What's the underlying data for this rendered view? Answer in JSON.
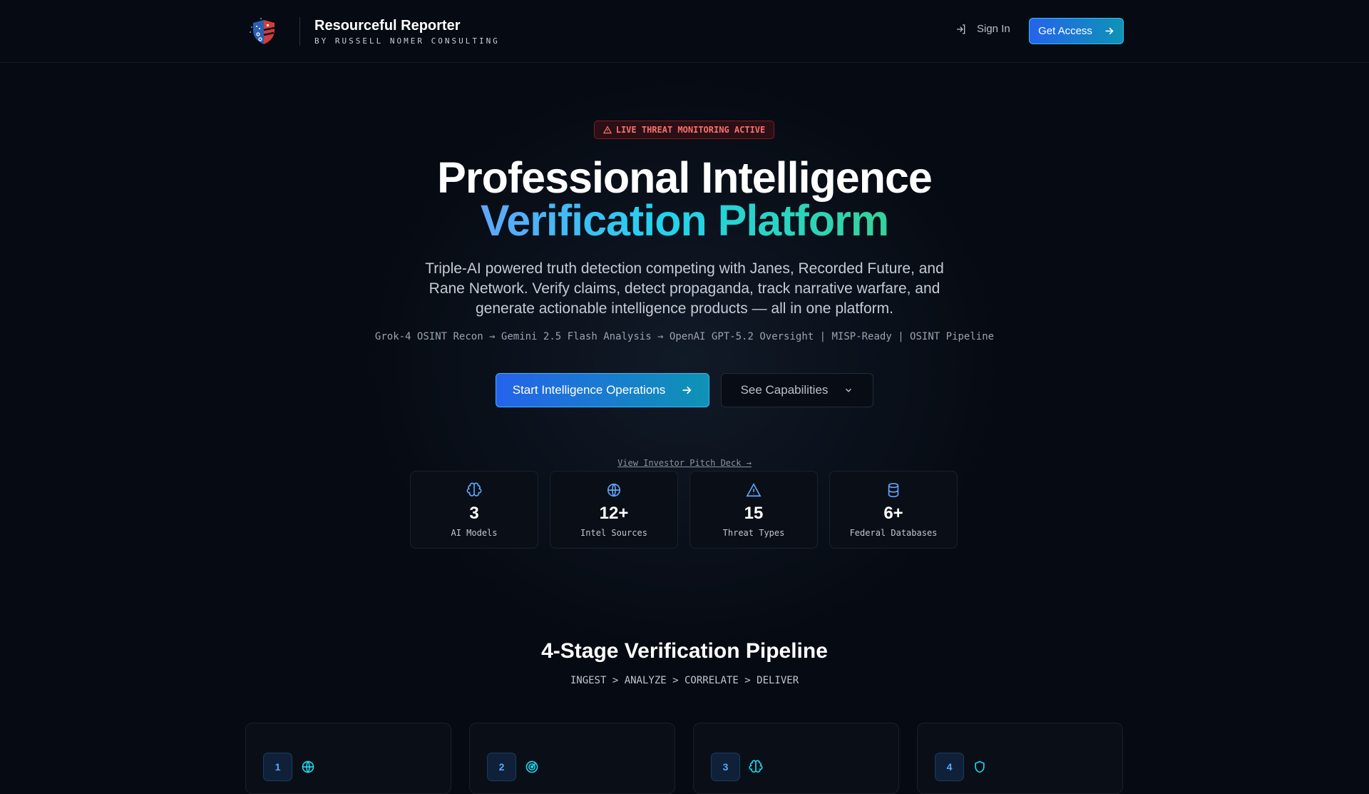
{
  "header": {
    "brand": "Resourceful Reporter",
    "subtitle": "BY RUSSELL NOMER CONSULTING",
    "sign_in": "Sign In",
    "get_access": "Get Access"
  },
  "hero": {
    "badge": "LIVE THREAT MONITORING ACTIVE",
    "title_line1": "Professional Intelligence",
    "title_line2": "Verification Platform",
    "lead": "Triple-AI powered truth detection competing with Janes, Recorded Future, and Rane Network. Verify claims, detect propaganda, track narrative warfare, and generate actionable intelligence products — all in one platform.",
    "pipeline": "Grok-4 OSINT Recon → Gemini 2.5 Flash Analysis → OpenAI GPT-5.2 Oversight | MISP-Ready | OSINT Pipeline",
    "primary_cta": "Start Intelligence Operations",
    "secondary_cta": "See Capabilities",
    "pitch_link": "View Investor Pitch Deck →"
  },
  "stats": [
    {
      "icon": "brain-icon",
      "value": "3",
      "label": "AI Models"
    },
    {
      "icon": "globe-icon",
      "value": "12+",
      "label": "Intel Sources"
    },
    {
      "icon": "warning-icon",
      "value": "15",
      "label": "Threat Types"
    },
    {
      "icon": "database-icon",
      "value": "6+",
      "label": "Federal Databases"
    }
  ],
  "pipeline_section": {
    "title": "4-Stage Verification Pipeline",
    "subtitle": "INGEST > ANALYZE > CORRELATE > DELIVER",
    "stages": [
      {
        "number": "1",
        "icon": "globe-icon"
      },
      {
        "number": "2",
        "icon": "radar-icon"
      },
      {
        "number": "3",
        "icon": "brain-icon"
      },
      {
        "number": "4",
        "icon": "shield-icon"
      }
    ]
  },
  "colors": {
    "accent_blue": "#2563eb",
    "accent_teal": "#0e93b5",
    "alert_red": "#f87171",
    "icon_blue": "#60a5fa",
    "icon_cyan": "#22d3ee"
  }
}
